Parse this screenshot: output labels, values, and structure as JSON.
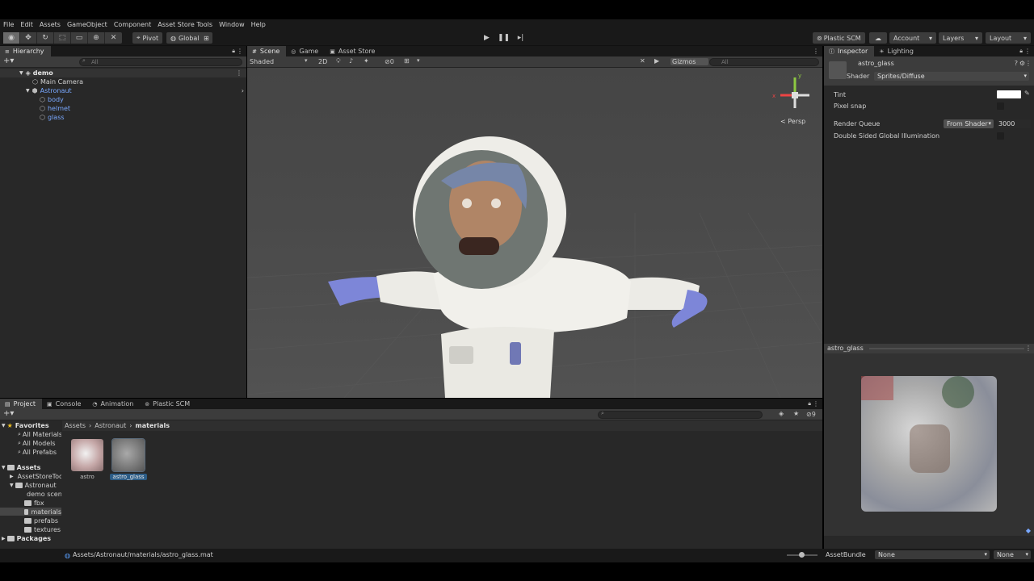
{
  "menu": [
    "File",
    "Edit",
    "Assets",
    "GameObject",
    "Component",
    "Asset Store Tools",
    "Window",
    "Help"
  ],
  "toolbar": {
    "pivot_label": "Pivot",
    "global_label": "Global",
    "plastic_label": "Plastic SCM",
    "account_label": "Account",
    "layers_label": "Layers",
    "layout_label": "Layout"
  },
  "hierarchy": {
    "tab_label": "Hierarchy",
    "search_placeholder": "All",
    "scene_name": "demo",
    "items": [
      {
        "label": "Main Camera"
      },
      {
        "label": "Astronaut"
      },
      {
        "label": "body"
      },
      {
        "label": "helmet"
      },
      {
        "label": "glass"
      }
    ]
  },
  "scene": {
    "tabs": [
      "Scene",
      "Game",
      "Asset Store"
    ],
    "shading": "Shaded",
    "mode_2d": "2D",
    "hidden_count": "0",
    "gizmos_label": "Gizmos",
    "search_placeholder": "All",
    "persp_label": "< Persp",
    "gizmo_axes": {
      "y": "y",
      "x": "x"
    }
  },
  "inspector": {
    "tabs": [
      "Inspector",
      "Lighting"
    ],
    "material_name": "astro_glass",
    "shader_label": "Shader",
    "shader_value": "Sprites/Diffuse",
    "tint_label": "Tint",
    "pixel_snap_label": "Pixel snap",
    "render_queue_label": "Render Queue",
    "render_queue_mode": "From Shader",
    "render_queue_value": "3000",
    "double_sided_label": "Double Sided Global Illumination",
    "preview_title": "astro_glass",
    "assetbundle_label": "AssetBundle",
    "assetbundle_value": "None",
    "assetbundle_variant": "None"
  },
  "project": {
    "tabs": [
      "Project",
      "Console",
      "Animation",
      "Plastic SCM"
    ],
    "hidden_count": "9",
    "breadcrumb": [
      "Assets",
      "Astronaut",
      "materials"
    ],
    "favorites_label": "Favorites",
    "favorites": [
      "All Materials",
      "All Models",
      "All Prefabs"
    ],
    "assets_label": "Assets",
    "assets_tree": [
      "AssetStoreTools",
      "Astronaut",
      "demo scene",
      "fbx",
      "materials",
      "prefabs",
      "textures"
    ],
    "packages_label": "Packages",
    "files": [
      {
        "name": "astro"
      },
      {
        "name": "astro_glass"
      }
    ],
    "status_path": "Assets/Astronaut/materials/astro_glass.mat"
  },
  "colors": {
    "panel": "#282828",
    "header": "#3c3c3c",
    "selection": "#2c5d87",
    "scene_bg": "#4a4a4a"
  }
}
